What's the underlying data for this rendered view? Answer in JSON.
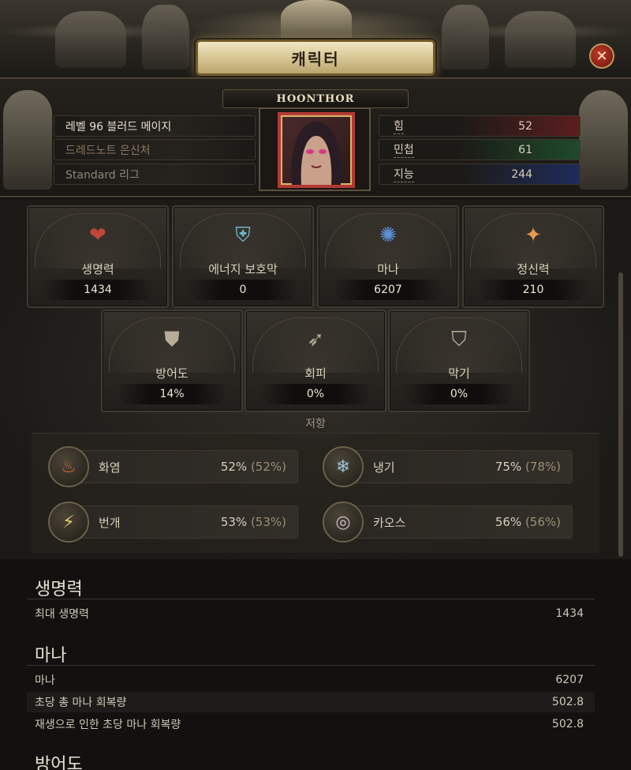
{
  "window": {
    "title": "캐릭터",
    "close_icon": "close-icon"
  },
  "character": {
    "name": "HOONTHOR",
    "level_class": "레벨 96 블러드 메이지",
    "hideout": "드레드노트 은신처",
    "league": "Standard 리그"
  },
  "attributes": [
    {
      "label": "힘",
      "value": "52",
      "color": "#8a2b2b"
    },
    {
      "label": "민첩",
      "value": "61",
      "color": "#2b6a3a"
    },
    {
      "label": "지능",
      "value": "244",
      "color": "#2b3f8a"
    }
  ],
  "pools": [
    {
      "label": "생명력",
      "value": "1434",
      "icon": "heart-icon",
      "color": "#c0453b"
    },
    {
      "label": "에너지 보호막",
      "value": "0",
      "icon": "energy-shield-icon",
      "color": "#6fb7c9"
    },
    {
      "label": "마나",
      "value": "6207",
      "icon": "mana-icon",
      "color": "#5c8fd6"
    },
    {
      "label": "정신력",
      "value": "210",
      "icon": "spirit-icon",
      "color": "#e59a52"
    }
  ],
  "defences": [
    {
      "label": "방어도",
      "value": "14%",
      "icon": "armour-icon"
    },
    {
      "label": "회피",
      "value": "0%",
      "icon": "evasion-icon"
    },
    {
      "label": "막기",
      "value": "0%",
      "icon": "block-icon"
    }
  ],
  "resistances": {
    "title": "저항",
    "items": [
      {
        "label": "화염",
        "value": "52%",
        "cap": "(52%)",
        "icon": "fire-icon",
        "color": "#d8643a"
      },
      {
        "label": "냉기",
        "value": "75%",
        "cap": "(78%)",
        "icon": "cold-icon",
        "color": "#9fc5dc"
      },
      {
        "label": "번개",
        "value": "53%",
        "cap": "(53%)",
        "icon": "lightning-icon",
        "color": "#e8d26a"
      },
      {
        "label": "카오스",
        "value": "56%",
        "cap": "(56%)",
        "icon": "chaos-icon",
        "color": "#c9b9d0"
      }
    ]
  },
  "details": {
    "life": {
      "heading": "생명력",
      "rows": [
        {
          "label": "최대 생명력",
          "value": "1434"
        }
      ]
    },
    "mana": {
      "heading": "마나",
      "rows": [
        {
          "label": "마나",
          "value": "6207"
        },
        {
          "label": "초당 총 마나 회복량",
          "value": "502.8"
        },
        {
          "label": "재생으로 인한 초당 마나 회복량",
          "value": "502.8"
        }
      ]
    },
    "armour": {
      "heading": "방어도"
    }
  }
}
